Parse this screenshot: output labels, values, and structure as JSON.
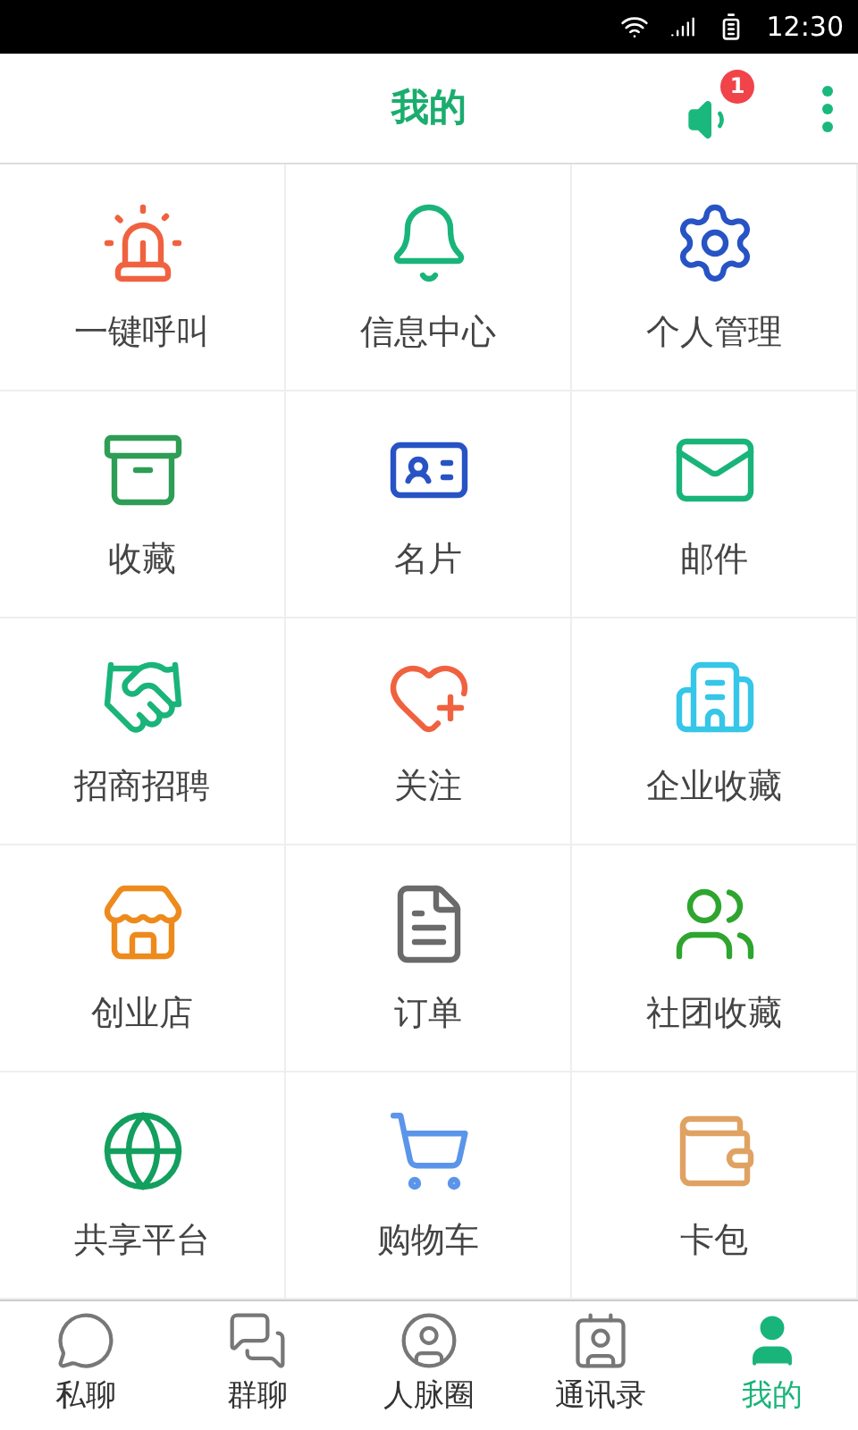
{
  "status_bar": {
    "time": "12:30"
  },
  "header": {
    "title": "我的",
    "badge": "1"
  },
  "grid": {
    "items": [
      {
        "label": "一键呼叫"
      },
      {
        "label": "信息中心"
      },
      {
        "label": "个人管理"
      },
      {
        "label": "收藏"
      },
      {
        "label": "名片"
      },
      {
        "label": "邮件"
      },
      {
        "label": "招商招聘"
      },
      {
        "label": "关注"
      },
      {
        "label": "企业收藏"
      },
      {
        "label": "创业店"
      },
      {
        "label": "订单"
      },
      {
        "label": "社团收藏"
      },
      {
        "label": "共享平台"
      },
      {
        "label": "购物车"
      },
      {
        "label": "卡包"
      }
    ]
  },
  "bottom_nav": {
    "items": [
      {
        "label": "私聊",
        "selected": false
      },
      {
        "label": "群聊",
        "selected": false
      },
      {
        "label": "人脉圈",
        "selected": false
      },
      {
        "label": "通讯录",
        "selected": false
      },
      {
        "label": "我的",
        "selected": true
      }
    ]
  }
}
